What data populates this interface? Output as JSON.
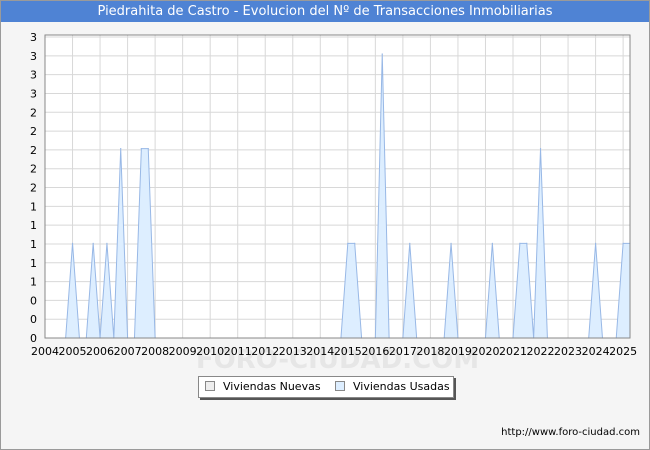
{
  "page": {
    "title": "Piedrahita de Castro - Evolucion del Nº de Transacciones Inmobiliarias",
    "footer_url": "http://www.foro-ciudad.com",
    "watermark": "FORO-CIUDAD.COM"
  },
  "colors": {
    "title_bg": "#4f83d4",
    "usadas_fill": "#ddeeff",
    "usadas_stroke": "#98b8e6",
    "nuevas_fill": "#eeeeee",
    "grid": "#d8d8d8"
  },
  "chart_data": {
    "type": "area",
    "title": "Piedrahita de Castro - Evolucion del Nº de Transacciones Inmobiliarias",
    "xlabel": "",
    "ylabel": "",
    "x_ticks": [
      "2004",
      "2005",
      "2006",
      "2007",
      "2008",
      "2009",
      "2010",
      "2011",
      "2012",
      "2013",
      "2014",
      "2015",
      "2016",
      "2017",
      "2018",
      "2019",
      "2020",
      "2021",
      "2022",
      "2023",
      "2024",
      "2025"
    ],
    "y_ticks": [
      "0",
      "0",
      "0",
      "1",
      "1",
      "1",
      "1",
      "1",
      "2",
      "2",
      "2",
      "2",
      "2",
      "3",
      "3",
      "3",
      "3"
    ],
    "xlim": [
      2004,
      2025.25
    ],
    "ylim": [
      0,
      3.2
    ],
    "grid": true,
    "legend_position": "bottom",
    "series": [
      {
        "name": "Viviendas Nuevas",
        "points": []
      },
      {
        "name": "Viviendas Usadas",
        "points": [
          [
            2004.75,
            0
          ],
          [
            2005.0,
            1
          ],
          [
            2005.25,
            0
          ],
          [
            2005.5,
            0
          ],
          [
            2005.75,
            1
          ],
          [
            2006.0,
            0
          ],
          [
            2006.25,
            1
          ],
          [
            2006.5,
            0
          ],
          [
            2006.75,
            2
          ],
          [
            2007.0,
            0
          ],
          [
            2007.25,
            0
          ],
          [
            2007.5,
            2
          ],
          [
            2007.75,
            2
          ],
          [
            2008.0,
            0
          ],
          [
            2014.75,
            0
          ],
          [
            2015.0,
            1
          ],
          [
            2015.25,
            1
          ],
          [
            2015.5,
            0
          ],
          [
            2016.0,
            0
          ],
          [
            2016.25,
            3
          ],
          [
            2016.5,
            0
          ],
          [
            2017.0,
            0
          ],
          [
            2017.25,
            1
          ],
          [
            2017.5,
            0
          ],
          [
            2018.5,
            0
          ],
          [
            2018.75,
            1
          ],
          [
            2019.0,
            0
          ],
          [
            2020.0,
            0
          ],
          [
            2020.25,
            1
          ],
          [
            2020.5,
            0
          ],
          [
            2021.0,
            0
          ],
          [
            2021.25,
            1
          ],
          [
            2021.5,
            1
          ],
          [
            2021.75,
            0
          ],
          [
            2022.0,
            2
          ],
          [
            2022.25,
            0
          ],
          [
            2023.75,
            0
          ],
          [
            2024.0,
            1
          ],
          [
            2024.25,
            0
          ],
          [
            2024.75,
            0
          ],
          [
            2025.0,
            1
          ],
          [
            2025.25,
            1
          ]
        ]
      }
    ]
  }
}
